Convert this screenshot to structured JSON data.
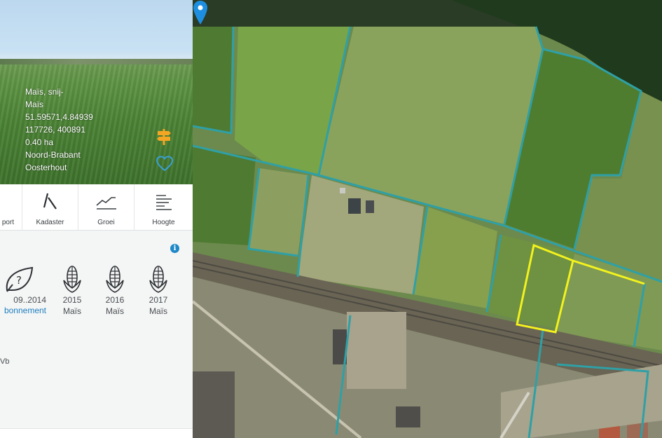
{
  "parcel": {
    "crop_type": "Maïs, snij-",
    "crop": "Maïs",
    "coordinates": "51.59571,4.84939",
    "rd_coordinates": "117726, 400891",
    "area": "0.40 ha",
    "province": "Noord-Brabant",
    "municipality": "Oosterhout"
  },
  "toolbar": {
    "items": [
      {
        "label": "port",
        "icon": "report-icon"
      },
      {
        "label": "Kadaster",
        "icon": "kadaster-icon"
      },
      {
        "label": "Groei",
        "icon": "growth-chart-icon"
      },
      {
        "label": "Hoogte",
        "icon": "height-icon"
      }
    ]
  },
  "history": {
    "locked": {
      "years": "09..2014",
      "link": "bonnement"
    },
    "crops": [
      {
        "year": "2015",
        "name": "Maïs",
        "icon": "corn-icon"
      },
      {
        "year": "2016",
        "name": "Maïs",
        "icon": "corn-icon"
      },
      {
        "year": "2017",
        "name": "Maïs",
        "icon": "corn-icon"
      }
    ]
  },
  "soil": {
    "text": "Vb"
  },
  "colors": {
    "parcel_outline": "#2fa0a6",
    "selected_parcel": "#f3f21e",
    "pin": "#1e8fe0",
    "link": "#1e7fc0",
    "accent_icon": "#f2a624"
  }
}
